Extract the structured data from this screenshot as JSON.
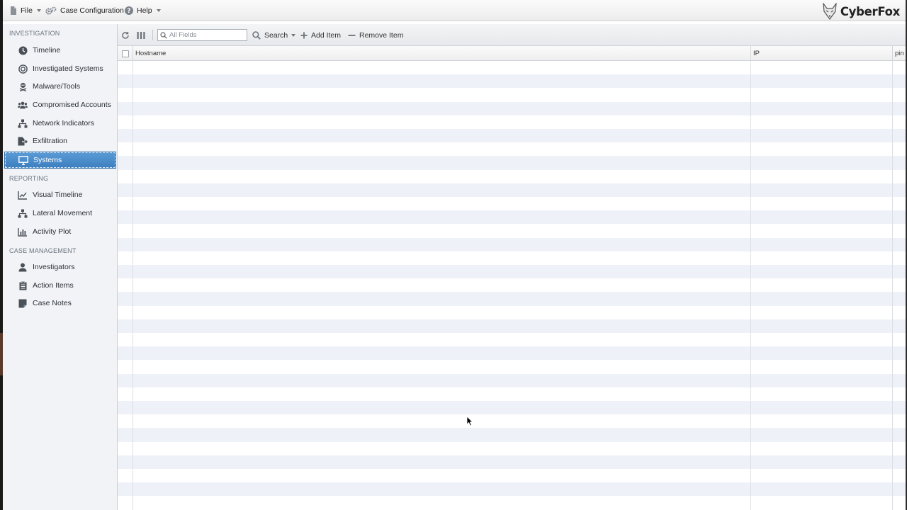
{
  "menubar": {
    "file_label": "File",
    "case_config_label": "Case Configuration",
    "help_label": "Help",
    "brand_name": "CyberFox"
  },
  "sidebar": {
    "sections": [
      {
        "title": "INVESTIGATION",
        "items": [
          {
            "label": "Timeline",
            "icon": "clock-icon"
          },
          {
            "label": "Investigated Systems",
            "icon": "target-icon"
          },
          {
            "label": "Malware/Tools",
            "icon": "skull-crossbones-icon"
          },
          {
            "label": "Compromised Accounts",
            "icon": "users-icon"
          },
          {
            "label": "Network Indicators",
            "icon": "network-icon"
          },
          {
            "label": "Exfiltration",
            "icon": "file-export-icon"
          },
          {
            "label": "Systems",
            "icon": "desktop-icon",
            "active": true
          }
        ]
      },
      {
        "title": "REPORTING",
        "items": [
          {
            "label": "Visual Timeline",
            "icon": "line-chart-icon"
          },
          {
            "label": "Lateral Movement",
            "icon": "network-icon"
          },
          {
            "label": "Activity Plot",
            "icon": "bar-chart-icon"
          }
        ]
      },
      {
        "title": "CASE MANAGEMENT",
        "items": [
          {
            "label": "Investigators",
            "icon": "user-icon"
          },
          {
            "label": "Action Items",
            "icon": "clipboard-icon"
          },
          {
            "label": "Case Notes",
            "icon": "sticky-note-icon"
          }
        ]
      }
    ]
  },
  "toolbar": {
    "search_placeholder": "All Fields",
    "search_label": "Search",
    "add_label": "Add Item",
    "remove_label": "Remove Item"
  },
  "grid": {
    "columns": [
      "Hostname",
      "IP",
      "pin"
    ],
    "rows": []
  },
  "colors": {
    "active_nav": "#3d7fbf",
    "row_alt": "#eef1f8",
    "sidebar_bg": "#f1f3f6"
  }
}
